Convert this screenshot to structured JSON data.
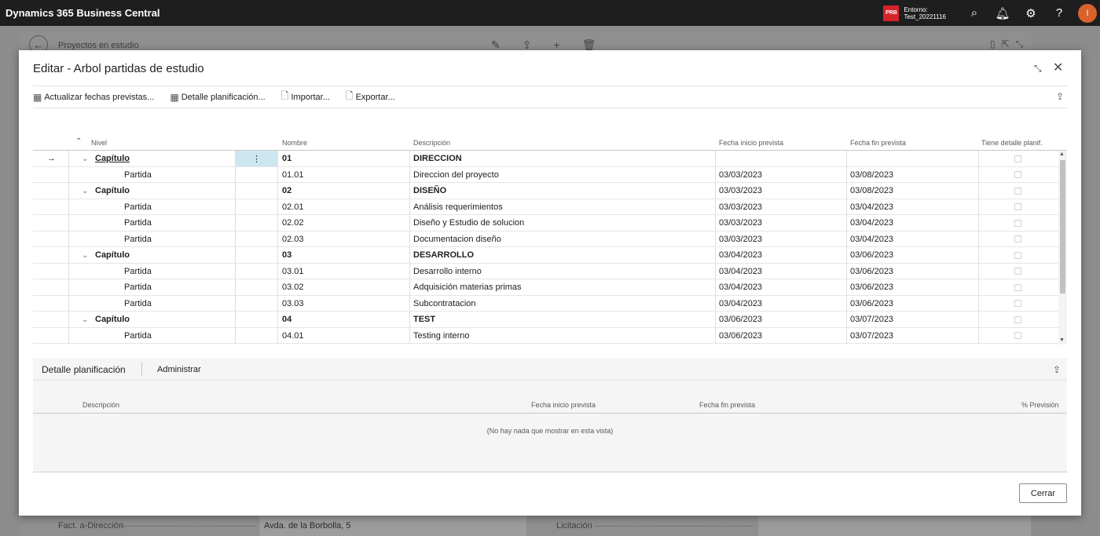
{
  "app": {
    "title": "Dynamics 365 Business Central",
    "env_badge": "PRB",
    "env_label": "Entorno:",
    "env_name": "Test_20221116",
    "avatar_initial": "I"
  },
  "background_page": {
    "title": "Proyectos en estudio",
    "footer": {
      "label1": "Fact. a-Dirección",
      "value1": "Avda. de la Borbolla, 5",
      "label2": "Licitación"
    }
  },
  "dialog": {
    "title": "Editar - Arbol partidas de estudio",
    "actions": [
      {
        "label": "Actualizar fechas previstas..."
      },
      {
        "label": "Detalle planificación..."
      },
      {
        "label": "Importar..."
      },
      {
        "label": "Exportar..."
      }
    ],
    "columns": {
      "nivel": "Nivel",
      "nombre": "Nombre",
      "descripcion": "Descripción",
      "fecha_inicio": "Fecha inicio prevista",
      "fecha_fin": "Fecha fin prevista",
      "tiene_detalle": "Tiene detalle planif."
    },
    "rows": [
      {
        "nivel": "Capítulo",
        "nombre": "01",
        "descripcion": "DIRECCION",
        "inicio": "",
        "fin": "",
        "tipo": "chapter"
      },
      {
        "nivel": "Partida",
        "nombre": "01.01",
        "descripcion": "Direccion del proyecto",
        "inicio": "03/03/2023",
        "fin": "03/08/2023",
        "tipo": "item"
      },
      {
        "nivel": "Capítulo",
        "nombre": "02",
        "descripcion": "DISEÑO",
        "inicio": "03/03/2023",
        "fin": "03/08/2023",
        "tipo": "chapter"
      },
      {
        "nivel": "Partida",
        "nombre": "02.01",
        "descripcion": "Análisis requerimientos",
        "inicio": "03/03/2023",
        "fin": "03/04/2023",
        "tipo": "item"
      },
      {
        "nivel": "Partida",
        "nombre": "02.02",
        "descripcion": "Diseño y Estudio de solucion",
        "inicio": "03/03/2023",
        "fin": "03/04/2023",
        "tipo": "item"
      },
      {
        "nivel": "Partida",
        "nombre": "02.03",
        "descripcion": "Documentacion diseño",
        "inicio": "03/03/2023",
        "fin": "03/04/2023",
        "tipo": "item"
      },
      {
        "nivel": "Capítulo",
        "nombre": "03",
        "descripcion": "DESARROLLO",
        "inicio": "03/04/2023",
        "fin": "03/06/2023",
        "tipo": "chapter"
      },
      {
        "nivel": "Partida",
        "nombre": "03.01",
        "descripcion": "Desarrollo interno",
        "inicio": "03/04/2023",
        "fin": "03/06/2023",
        "tipo": "item"
      },
      {
        "nivel": "Partida",
        "nombre": "03.02",
        "descripcion": "Adquisición materias primas",
        "inicio": "03/04/2023",
        "fin": "03/06/2023",
        "tipo": "item"
      },
      {
        "nivel": "Partida",
        "nombre": "03.03",
        "descripcion": "Subcontratacion",
        "inicio": "03/04/2023",
        "fin": "03/06/2023",
        "tipo": "item"
      },
      {
        "nivel": "Capítulo",
        "nombre": "04",
        "descripcion": "TEST",
        "inicio": "03/06/2023",
        "fin": "03/07/2023",
        "tipo": "chapter"
      },
      {
        "nivel": "Partida",
        "nombre": "04.01",
        "descripcion": "Testing interno",
        "inicio": "03/06/2023",
        "fin": "03/07/2023",
        "tipo": "item"
      }
    ],
    "part": {
      "title": "Detalle planificación",
      "admin": "Administrar",
      "columns": {
        "descripcion": "Descripción",
        "fecha_inicio": "Fecha inicio prevista",
        "fecha_fin": "Fecha fin prevista",
        "prevision": "% Previsión"
      },
      "empty": "(No hay nada que mostrar en esta vista)"
    },
    "close_label": "Cerrar"
  }
}
